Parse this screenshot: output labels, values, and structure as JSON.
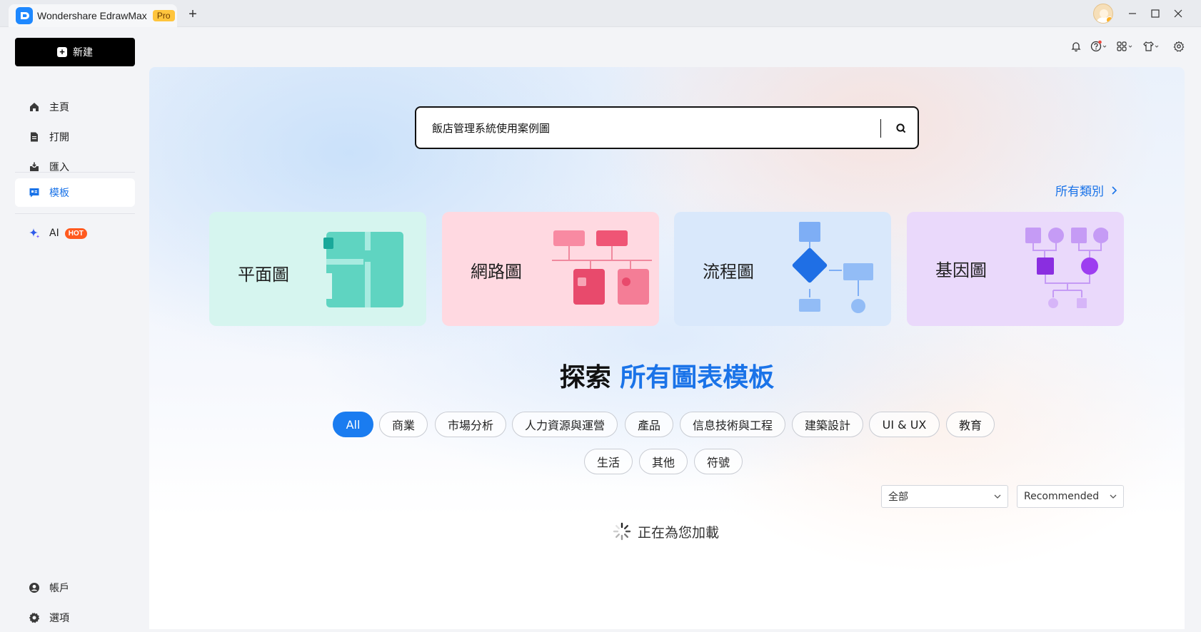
{
  "titlebar": {
    "app_name": "Wondershare EdrawMax",
    "pro_badge": "Pro",
    "new_tab": "+"
  },
  "sidebar": {
    "new_button": "新建",
    "items": [
      {
        "label": "主頁",
        "icon": "home-icon"
      },
      {
        "label": "打開",
        "icon": "file-icon"
      },
      {
        "label": "匯入",
        "icon": "import-icon"
      },
      {
        "label": "模板",
        "icon": "template-icon",
        "active": true
      },
      {
        "label": "AI",
        "icon": "sparkle-icon",
        "badge": "HOT"
      }
    ],
    "bottom_items": [
      {
        "label": "帳戶",
        "icon": "account-icon"
      },
      {
        "label": "選項",
        "icon": "gear-icon"
      }
    ]
  },
  "search": {
    "value": "飯店管理系統使用案例圖"
  },
  "all_categories": "所有類別",
  "cards": [
    {
      "label": "平面圖",
      "color": "#d6f5ef"
    },
    {
      "label": "網路圖",
      "color": "#ffd9e1"
    },
    {
      "label": "流程圖",
      "color": "#d9e8fb"
    },
    {
      "label": "基因圖",
      "color": "#ead9fb"
    }
  ],
  "explore": {
    "prefix": "探索",
    "accent": "所有圖表模板"
  },
  "filters": [
    "All",
    "商業",
    "市場分析",
    "人力資源與運營",
    "產品",
    "信息技術與工程",
    "建築設計",
    "UI & UX",
    "教育",
    "生活",
    "其他",
    "符號"
  ],
  "filter_selected": "All",
  "selects": {
    "scope": "全部",
    "sort": "Recommended"
  },
  "loading_text": "正在為您加載",
  "colors": {
    "accent": "#1a73e8",
    "chip_active": "#1a7cf0",
    "hot": "#ff5a1f",
    "pro": "#ffc53d"
  }
}
